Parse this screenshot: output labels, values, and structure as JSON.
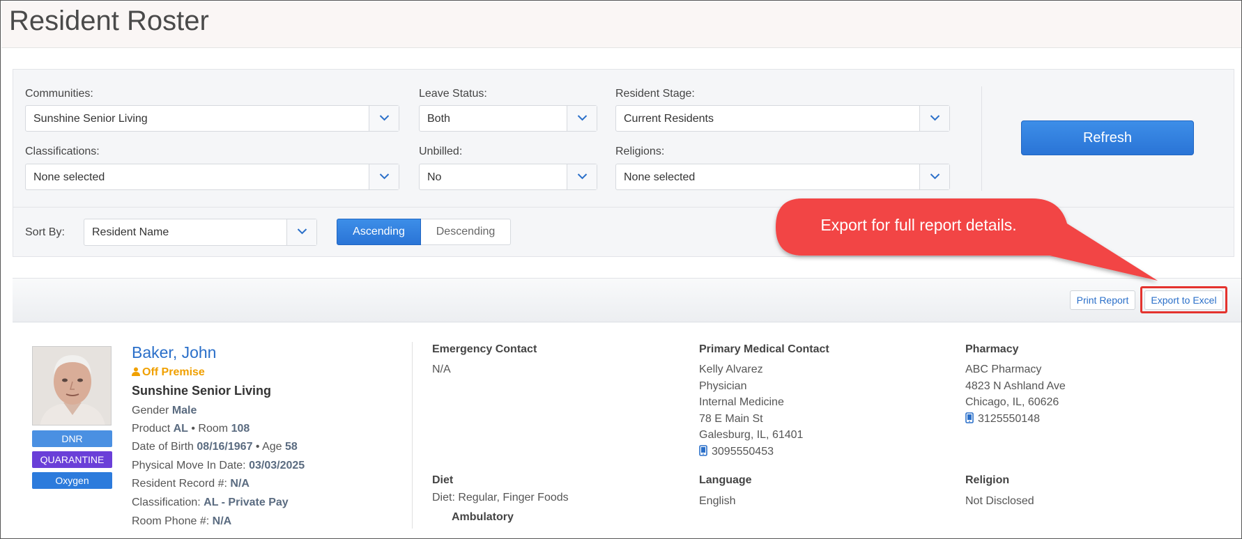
{
  "page": {
    "title": "Resident Roster"
  },
  "filters": {
    "communities": {
      "label": "Communities:",
      "value": "Sunshine Senior Living"
    },
    "leave_status": {
      "label": "Leave Status:",
      "value": "Both"
    },
    "resident_stage": {
      "label": "Resident Stage:",
      "value": "Current Residents"
    },
    "classifications": {
      "label": "Classifications:",
      "value": "None selected"
    },
    "unbilled": {
      "label": "Unbilled:",
      "value": "No"
    },
    "religions": {
      "label": "Religions:",
      "value": "None selected"
    },
    "refresh_label": "Refresh"
  },
  "sort": {
    "label": "Sort By:",
    "value": "Resident Name",
    "ascending_label": "Ascending",
    "descending_label": "Descending",
    "selected": "Ascending"
  },
  "toolbar": {
    "print_label": "Print Report",
    "export_label": "Export to Excel"
  },
  "callout": {
    "text": "Export for full report details."
  },
  "resident": {
    "name": "Baker, John",
    "status": "Off Premise",
    "community": "Sunshine Senior Living",
    "badges": [
      {
        "label": "DNR",
        "color": "#4a90e2"
      },
      {
        "label": "QUARANTINE",
        "color": "#6a3fd8"
      },
      {
        "label": "Oxygen",
        "color": "#2c7bdc"
      }
    ],
    "gender_label": "Gender",
    "gender": "Male",
    "product_label": "Product",
    "product": "AL",
    "room_label": "Room",
    "room": "108",
    "dob_label": "Date of Birth",
    "dob": "08/16/1967",
    "age_label": "Age",
    "age": "58",
    "move_in_label": "Physical Move In Date:",
    "move_in": "03/03/2025",
    "record_label": "Resident Record #:",
    "record": "N/A",
    "classification_label": "Classification:",
    "classification": "AL - Private Pay",
    "room_phone_label": "Room Phone #:",
    "room_phone": "N/A",
    "emergency_contact": {
      "heading": "Emergency Contact",
      "value": "N/A"
    },
    "primary_medical": {
      "heading": "Primary Medical Contact",
      "name": "Kelly Alvarez",
      "role": "Physician",
      "specialty": "Internal Medicine",
      "street": "78 E Main St",
      "city": "Galesburg, IL, 61401",
      "phone": "3095550453"
    },
    "pharmacy": {
      "heading": "Pharmacy",
      "name": "ABC Pharmacy",
      "street": "4823 N Ashland Ave",
      "city": "Chicago, IL, 60626",
      "phone": "3125550148"
    },
    "diet": {
      "heading": "Diet",
      "value": "Diet: Regular, Finger Foods",
      "mobility": "Ambulatory"
    },
    "language": {
      "heading": "Language",
      "value": "English"
    },
    "religion": {
      "heading": "Religion",
      "value": "Not Disclosed"
    }
  },
  "colors": {
    "accent": "#2a74d6",
    "link": "#2a6fc9",
    "warning": "#f0a000",
    "callout": "#f04444",
    "highlight": "#e4332e"
  }
}
